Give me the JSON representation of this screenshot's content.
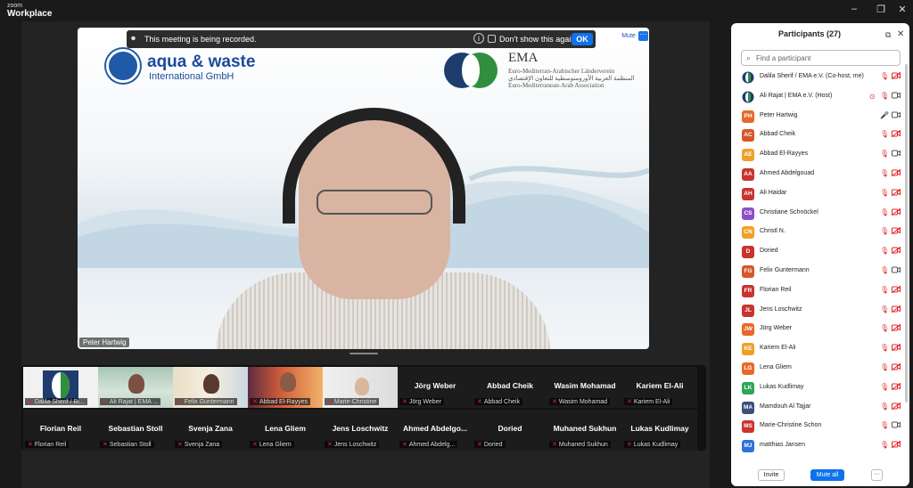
{
  "window": {
    "brand_line1": "zoom",
    "brand_line2": "Workplace",
    "minimize": "–",
    "restore": "❐",
    "close": "✕"
  },
  "recording_banner": {
    "message": "This meeting is being recorded.",
    "dont_show_label": "Don't show this again",
    "ok_label": "OK"
  },
  "main_video": {
    "speaker_label": "Peter Hartwig",
    "mute_label": "Mute",
    "more_label": "···",
    "slide": {
      "logo_left_title": "aqua & waste",
      "logo_left_subtitle": "International GmbH",
      "logo_right_title": "EMA",
      "logo_right_line1": "Euro-Mediterran-Arabischer Länderverein",
      "logo_right_line2": "المنظمة العربية الأورومتوسطية للتعاون الإقتصادي",
      "logo_right_line3": "Euro-Mediterranean-Arab Association"
    }
  },
  "gallery": {
    "row1": [
      {
        "name": "",
        "tag": "Dalila Sherif / Bi..."
      },
      {
        "name": "",
        "tag": "Ali Rajat | EMA ..."
      },
      {
        "name": "",
        "tag": "Felix Guntermann"
      },
      {
        "name": "",
        "tag": "Abbad El-Rayyes"
      },
      {
        "name": "",
        "tag": "Marie-Christine"
      },
      {
        "name": "Jörg Weber",
        "tag": "Jörg Weber"
      },
      {
        "name": "Abbad Cheik",
        "tag": "Abbad Cheik"
      },
      {
        "name": "Wasim Mohamad",
        "tag": "Wasim Mohamad"
      },
      {
        "name": "Kariem El-Ali",
        "tag": "Kariem El-Ali"
      }
    ],
    "row2": [
      {
        "name": "Florian Reil",
        "tag": "Florian Reil"
      },
      {
        "name": "Sebastian Stoll",
        "tag": "Sebastian Stoll"
      },
      {
        "name": "Svenja Zana",
        "tag": "Svenja Zana"
      },
      {
        "name": "Lena Gliem",
        "tag": "Lena Gliem"
      },
      {
        "name": "Jens Loschwitz",
        "tag": "Jens Loschwitz"
      },
      {
        "name": "Ahmed Abdelgo...",
        "tag": "Ahmed Abdelg..."
      },
      {
        "name": "Doried",
        "tag": "Doried"
      },
      {
        "name": "Muhaned Sukhun",
        "tag": "Muhaned Sukhun"
      },
      {
        "name": "Lukas Kudlimay",
        "tag": "Lukas Kudlimay"
      }
    ]
  },
  "participants": {
    "title": "Participants (27)",
    "search_placeholder": "Find a participant",
    "invite_label": "Invite",
    "mute_all_label": "Mute all",
    "more_label": "···",
    "list": [
      {
        "initials": "",
        "name": "Dalila Sherif / EMA e.V. (Co-host, me)",
        "color": "#1f5a9e",
        "logo": true,
        "mic": "muted",
        "cam": "off"
      },
      {
        "initials": "",
        "name": "Ali Rajat | EMA e.V. (Host)",
        "color": "#1f5a9e",
        "logo": true,
        "mic": "muted",
        "cam": "on",
        "rec": true
      },
      {
        "initials": "PH",
        "name": "Peter Hartwig",
        "color": "#e8692b",
        "mic": "on",
        "cam": "on"
      },
      {
        "initials": "AC",
        "name": "Abbad Cheik",
        "color": "#d5572a",
        "mic": "muted",
        "cam": "off"
      },
      {
        "initials": "AE",
        "name": "Abbad El-Rayyes",
        "color": "#f0a029",
        "mic": "muted",
        "cam": "on"
      },
      {
        "initials": "AA",
        "name": "Ahmed Abdelgouad",
        "color": "#c9342e",
        "mic": "muted",
        "cam": "off"
      },
      {
        "initials": "AH",
        "name": "Ali Haidar",
        "color": "#c9342e",
        "mic": "muted",
        "cam": "off"
      },
      {
        "initials": "CS",
        "name": "Christiane Schnöckel",
        "color": "#8e4fc6",
        "mic": "muted",
        "cam": "off"
      },
      {
        "initials": "CN",
        "name": "Christl N.",
        "color": "#f0a029",
        "mic": "muted",
        "cam": "off"
      },
      {
        "initials": "D",
        "name": "Doried",
        "color": "#c9342e",
        "mic": "muted",
        "cam": "off"
      },
      {
        "initials": "FG",
        "name": "Felix Guntermann",
        "color": "#d5572a",
        "mic": "muted",
        "cam": "on"
      },
      {
        "initials": "FR",
        "name": "Florian Reil",
        "color": "#c9342e",
        "mic": "muted",
        "cam": "off"
      },
      {
        "initials": "JL",
        "name": "Jens Loschwitz",
        "color": "#c9342e",
        "mic": "muted",
        "cam": "off"
      },
      {
        "initials": "JW",
        "name": "Jörg Weber",
        "color": "#e8692b",
        "mic": "muted",
        "cam": "off"
      },
      {
        "initials": "KE",
        "name": "Kariem El-Ali",
        "color": "#f0a029",
        "mic": "muted",
        "cam": "off"
      },
      {
        "initials": "LG",
        "name": "Lena Gliem",
        "color": "#e8692b",
        "mic": "muted",
        "cam": "off"
      },
      {
        "initials": "LK",
        "name": "Lukas Kudlimay",
        "color": "#2ea65a",
        "mic": "muted",
        "cam": "off"
      },
      {
        "initials": "MA",
        "name": "Mamdouh Al Tajjar",
        "color": "#3a4f7a",
        "mic": "muted",
        "cam": "off"
      },
      {
        "initials": "MS",
        "name": "Marie-Christine Schon",
        "color": "#c9342e",
        "mic": "muted",
        "cam": "on"
      },
      {
        "initials": "MJ",
        "name": "matthias Jansen",
        "color": "#2d72d9",
        "mic": "muted",
        "cam": "off"
      }
    ]
  },
  "icons": {
    "search": "⌕",
    "popout": "⧉",
    "close": "✕",
    "info": "i",
    "mic_muted": "🎙",
    "cam": "▭"
  }
}
